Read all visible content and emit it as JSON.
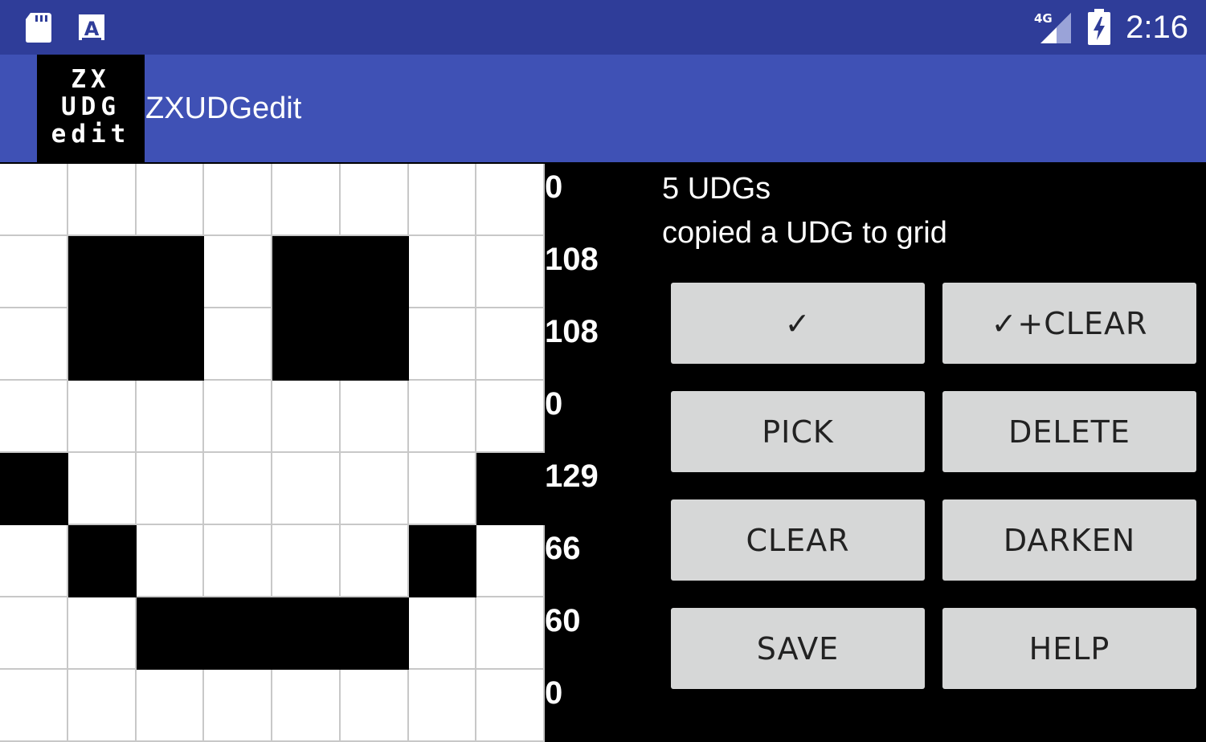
{
  "status_bar": {
    "time": "2:16",
    "network": "4G",
    "left_icons": [
      "sd-card-icon",
      "text-input-icon"
    ],
    "right_icons": [
      "signal-icon",
      "battery-charging-icon"
    ]
  },
  "app_bar": {
    "logo_lines": [
      "ZX",
      "UDG",
      "edit"
    ],
    "title": "ZXUDGedit"
  },
  "grid": {
    "rows": [
      [
        0,
        0,
        0,
        0,
        0,
        0,
        0,
        0
      ],
      [
        0,
        1,
        1,
        0,
        1,
        1,
        0,
        0
      ],
      [
        0,
        1,
        1,
        0,
        1,
        1,
        0,
        0
      ],
      [
        0,
        0,
        0,
        0,
        0,
        0,
        0,
        0
      ],
      [
        1,
        0,
        0,
        0,
        0,
        0,
        0,
        1
      ],
      [
        0,
        1,
        0,
        0,
        0,
        0,
        1,
        0
      ],
      [
        0,
        0,
        1,
        1,
        1,
        1,
        0,
        0
      ],
      [
        0,
        0,
        0,
        0,
        0,
        0,
        0,
        0
      ]
    ],
    "row_values": [
      "0",
      "108",
      "108",
      "0",
      "129",
      "66",
      "60",
      "0"
    ]
  },
  "info": {
    "count": "5 UDGs",
    "message": "copied a UDG to grid"
  },
  "buttons": [
    {
      "label": "✓",
      "name": "check-button"
    },
    {
      "label": "✓+CLEAR",
      "name": "check-clear-button"
    },
    {
      "label": "PICK",
      "name": "pick-button"
    },
    {
      "label": "DELETE",
      "name": "delete-button"
    },
    {
      "label": "CLEAR",
      "name": "clear-button"
    },
    {
      "label": "DARKEN",
      "name": "darken-button"
    },
    {
      "label": "SAVE",
      "name": "save-button"
    },
    {
      "label": "HELP",
      "name": "help-button"
    }
  ],
  "colors": {
    "status_bar": "#2f3d99",
    "app_bar": "#3f51b5",
    "button_bg": "#d6d7d7"
  }
}
